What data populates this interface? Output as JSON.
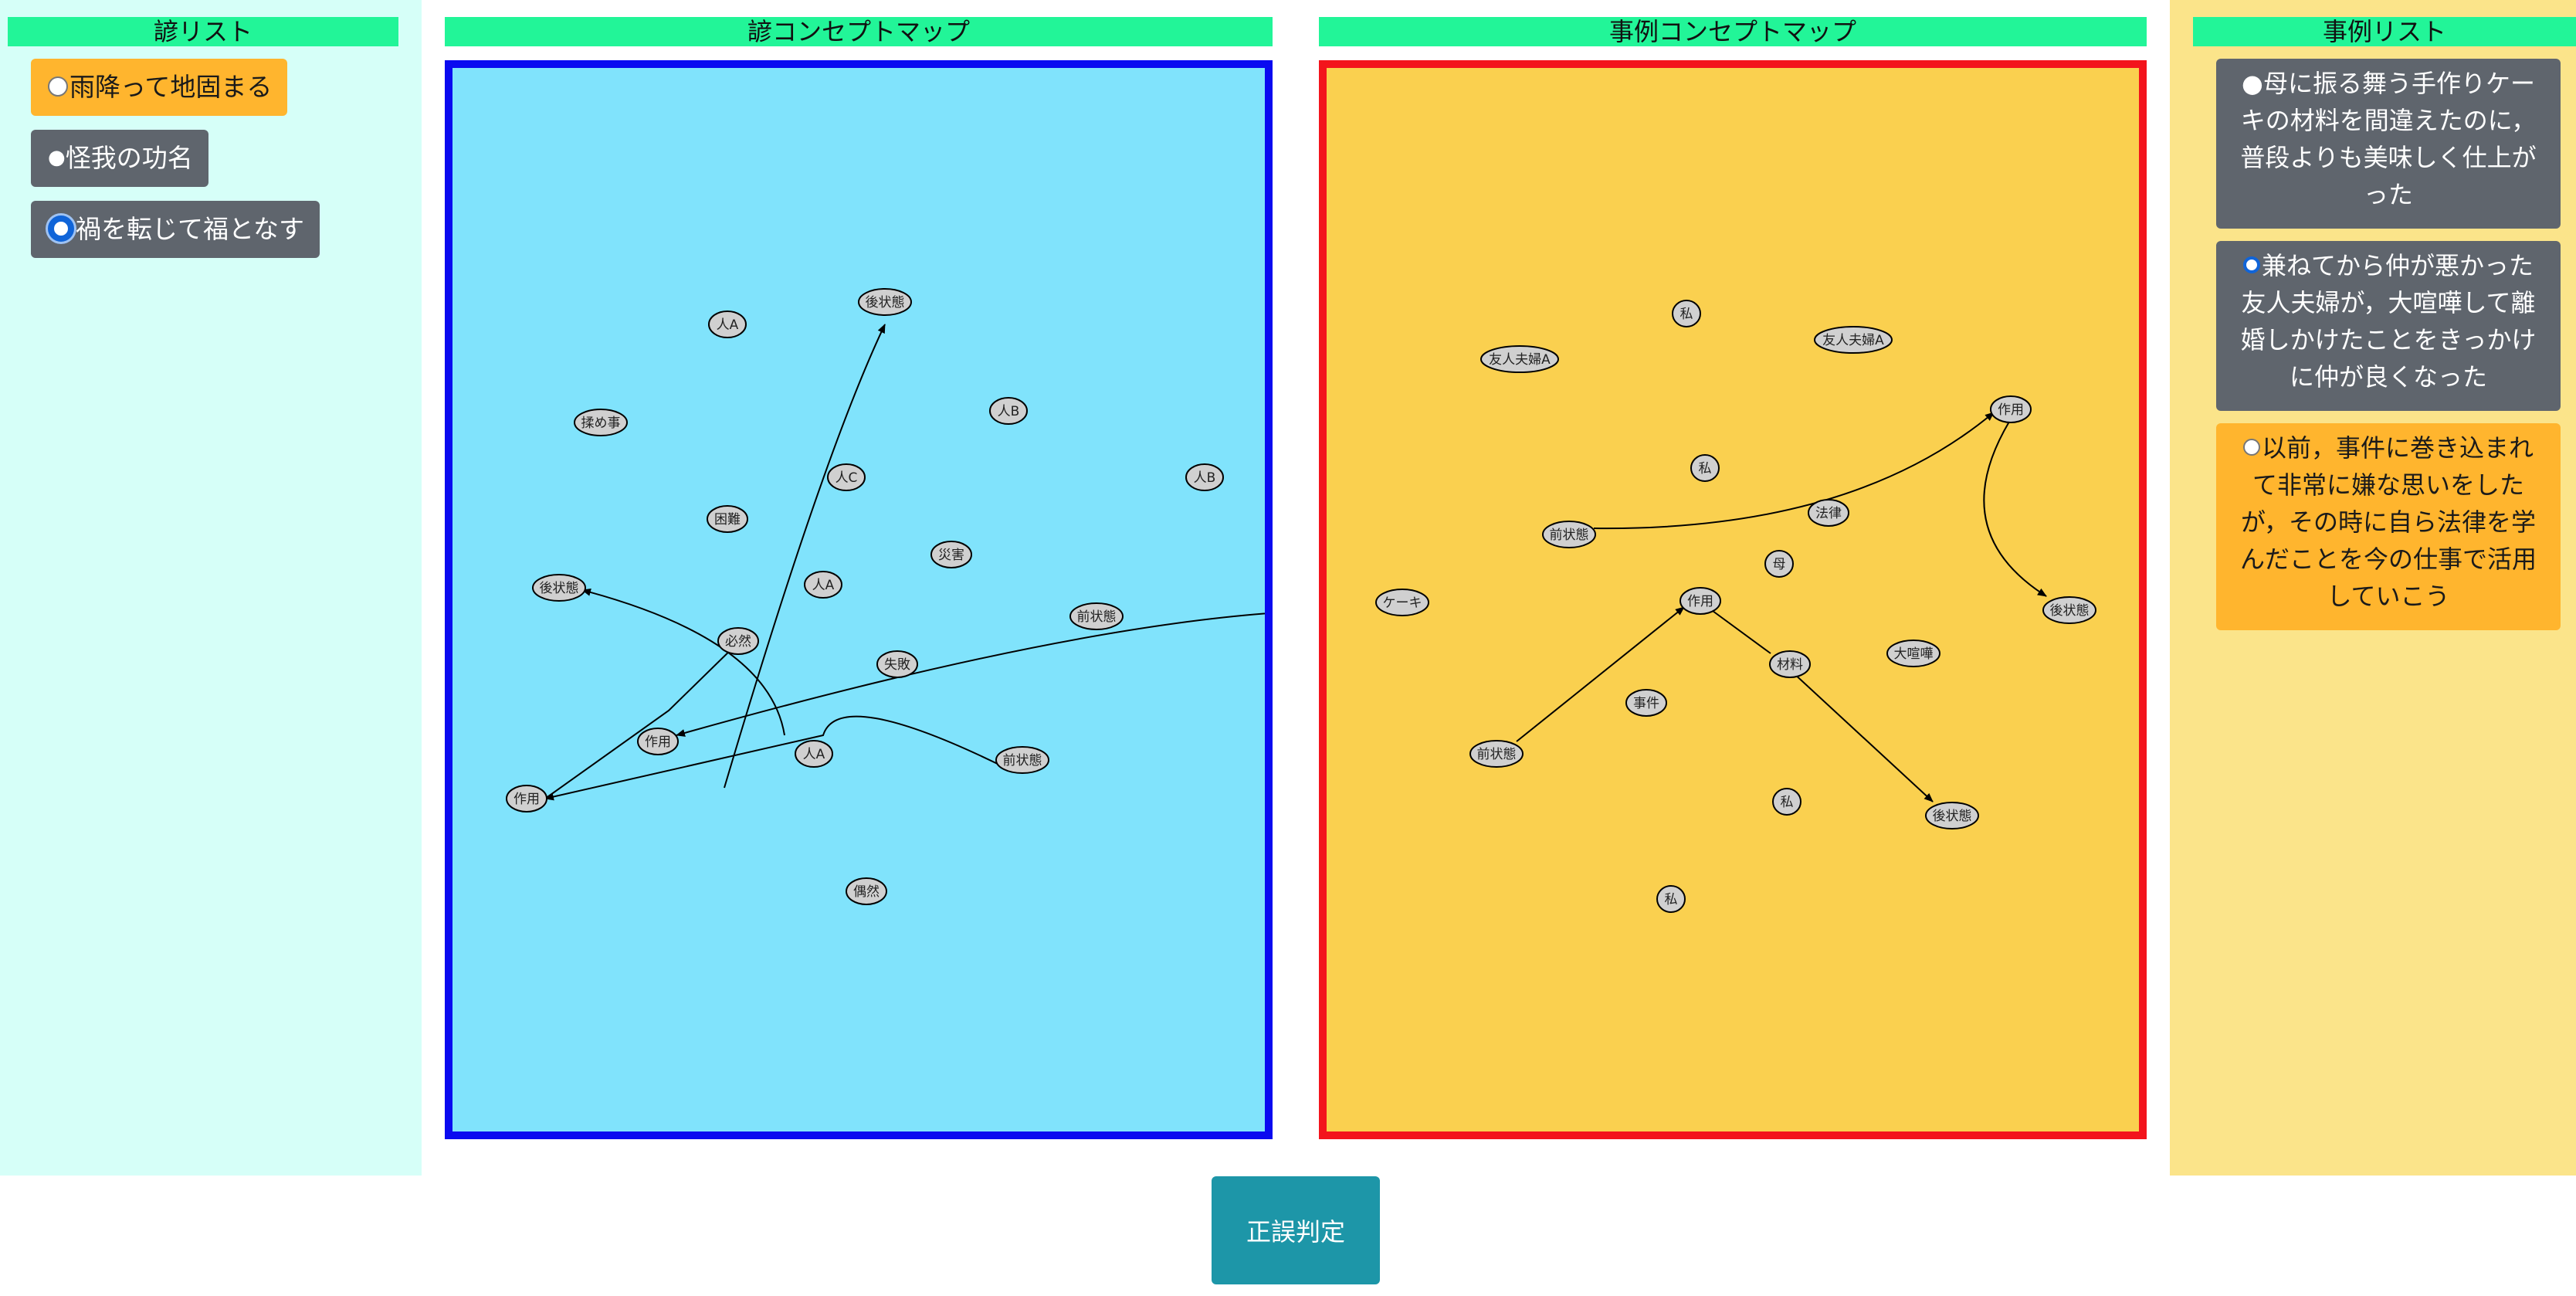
{
  "proverb_list": {
    "title": "諺リスト",
    "items": [
      {
        "label": "雨降って地固まる",
        "marker": "○"
      },
      {
        "label": "怪我の功名",
        "marker": "●"
      },
      {
        "label": "禍を転じて福となす",
        "marker": "◉"
      }
    ]
  },
  "proverb_map": {
    "title": "諺コンセプトマップ",
    "nodes": [
      "人A",
      "後状態",
      "揉め事",
      "人B",
      "人C",
      "人B",
      "困難",
      "災害",
      "後状態",
      "人A",
      "必然",
      "前状態",
      "失敗",
      "作用",
      "人A",
      "前状態",
      "作用",
      "偶然"
    ]
  },
  "case_map": {
    "title": "事例コンセプトマップ",
    "nodes": [
      "私",
      "友人夫婦A",
      "友人夫婦A",
      "作用",
      "私",
      "法律",
      "前状態",
      "母",
      "ケーキ",
      "作用",
      "後状態",
      "材料",
      "大喧嘩",
      "事件",
      "前状態",
      "私",
      "後状態",
      "私"
    ]
  },
  "case_list": {
    "title": "事例リスト",
    "items": [
      {
        "label": "●母に振る舞う手作りケーキの材料を間違えたのに，普段よりも美味しく仕上がった"
      },
      {
        "label": "兼ねてから仲が悪かった友人夫婦が，大喧嘩して離婚しかけたことをきっかけに仲が良くなった"
      },
      {
        "label": "以前，事件に巻き込まれて非常に嫌な思いをしたが，その時に自ら法律を学んだことを今の仕事で活用していこう"
      }
    ]
  },
  "judge_button": {
    "label": "正誤判定"
  },
  "colors": {
    "header": "#22f598",
    "proverb_map_bg": "#80e3fc",
    "proverb_map_border": "#0a0af0",
    "case_map_bg": "#fad04f",
    "case_map_border": "#f3141c",
    "orange_button": "#ffb52e",
    "gray_button": "#5f656d",
    "judge_button": "#1d96a8"
  }
}
